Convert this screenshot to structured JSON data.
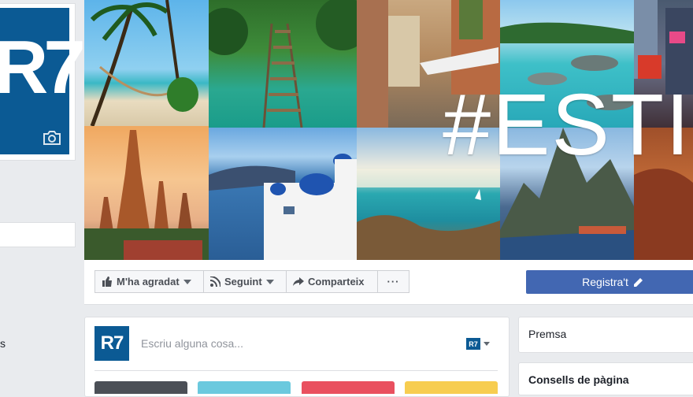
{
  "profile": {
    "logo_text": "R7",
    "camera_icon": "camera-icon"
  },
  "cover": {
    "overlay_text": "#ESTIU"
  },
  "actions": {
    "like_label": "M'ha agradat",
    "follow_label": "Seguint",
    "share_label": "Comparteix",
    "more_label": "···",
    "register_label": "Registra't"
  },
  "composer": {
    "avatar_text": "R7",
    "placeholder": "Escriu alguna cosa...",
    "mini_avatar_text": "R7"
  },
  "sidebar": {
    "premsa": "Premsa",
    "consells": "Consells de pàgina"
  },
  "left": {
    "fragment": "s"
  },
  "colors": {
    "brand": "#0b5a94",
    "facebook_blue": "#4267b2"
  }
}
